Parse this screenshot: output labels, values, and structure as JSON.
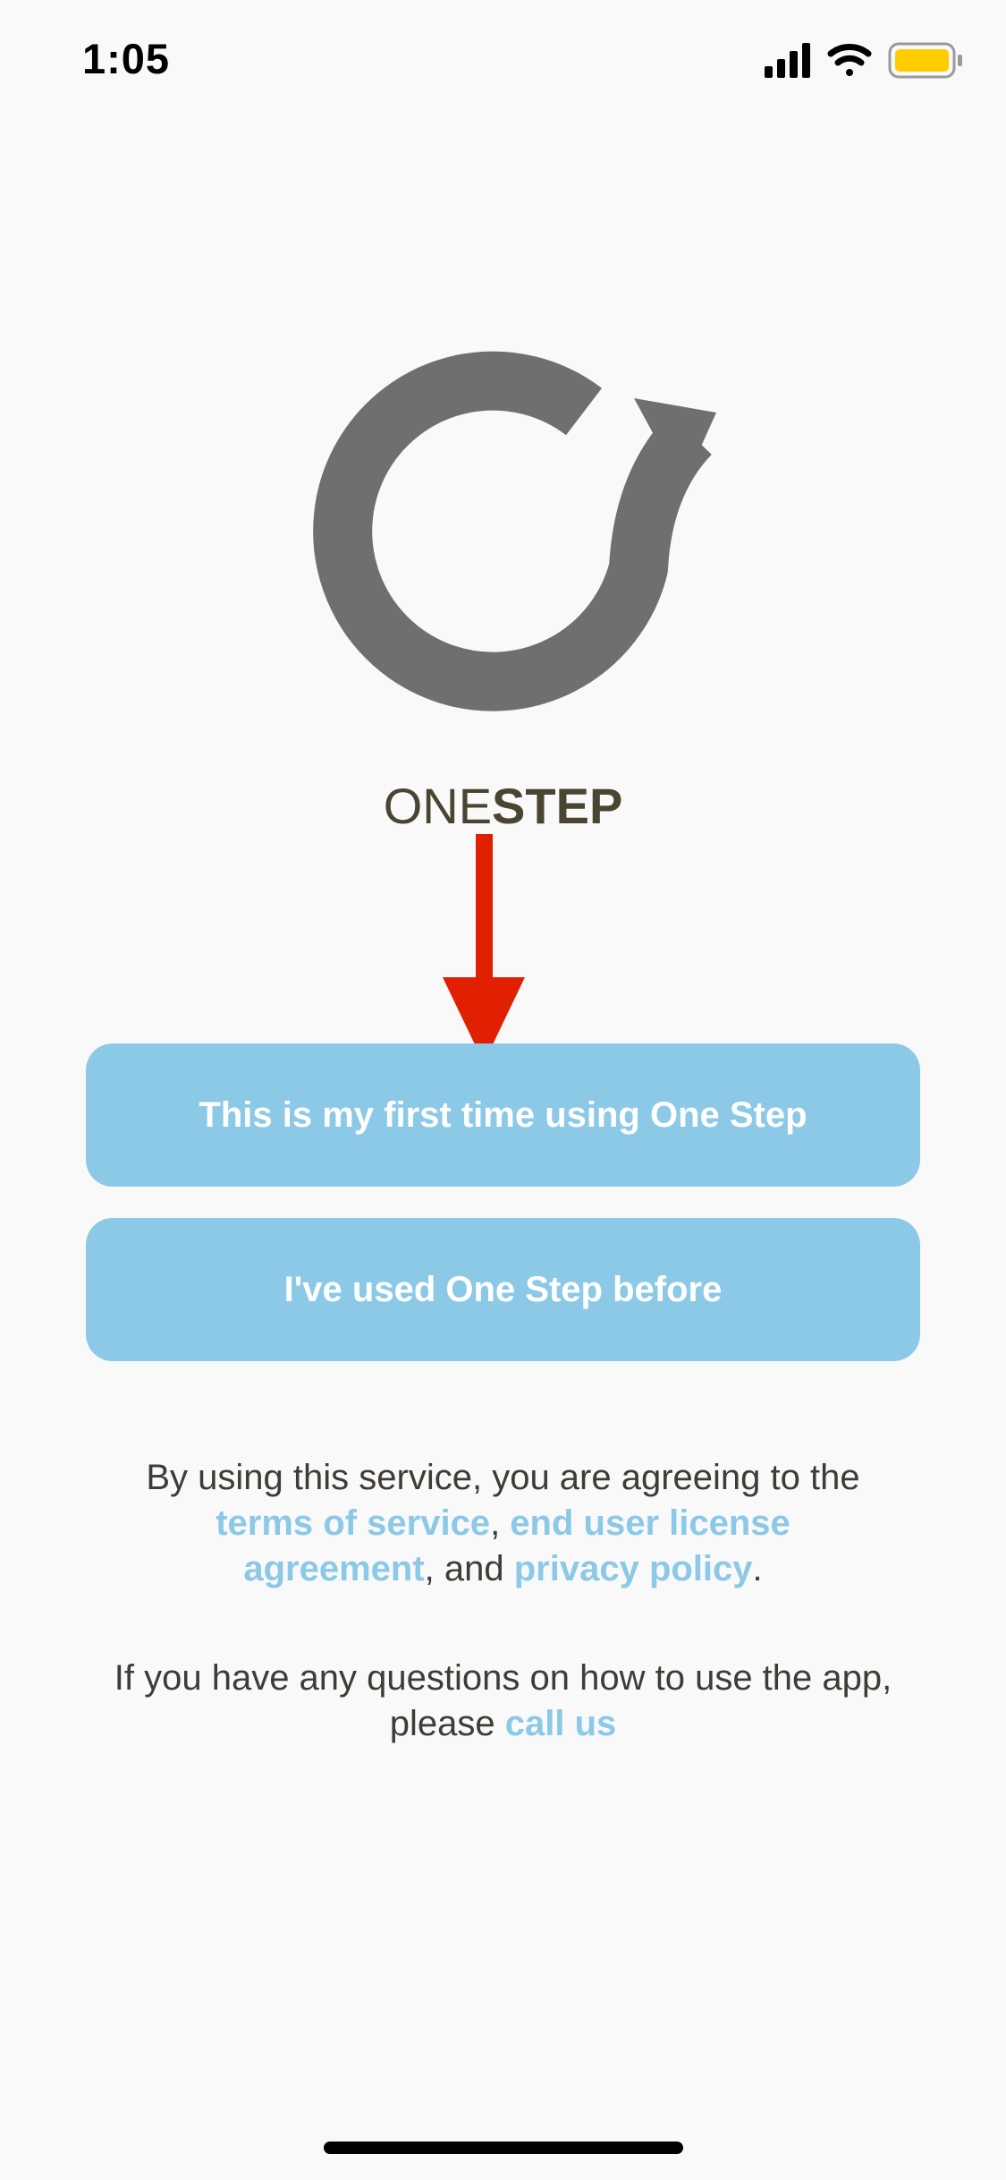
{
  "status_bar": {
    "time": "1:05",
    "icons": [
      "cellular-signal-icon",
      "wifi-icon",
      "battery-icon"
    ],
    "battery_color": "#ffcc00"
  },
  "logo": {
    "icon": "circular-arrow-logo",
    "color": "#6f6f6f"
  },
  "wordmark": {
    "light": "ONE",
    "bold": "STEP"
  },
  "annotation": {
    "icon": "red-down-arrow-icon",
    "color": "#e02000"
  },
  "buttons": {
    "first_time": "This is my first time using One Step",
    "returning": "I've used One Step before",
    "color": "#8bc9e6"
  },
  "legal": {
    "text1": "By using this service, you are agreeing to the ",
    "terms_link": "terms of service",
    "sep1": ", ",
    "eula_link": "end user license agreement",
    "sep2": ", and ",
    "privacy_link": "privacy policy",
    "end": "."
  },
  "help": {
    "text": "If you have any questions on how to use the app, please ",
    "call_link": "call us"
  }
}
